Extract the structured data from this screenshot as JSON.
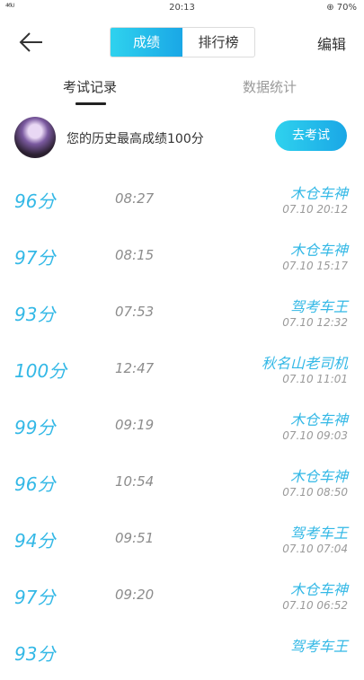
{
  "status_bar": {
    "signal": "⁴⁶ᴸᴵ",
    "time": "20:13",
    "battery": "⊕ 70%"
  },
  "nav": {
    "tab_score": "成绩",
    "tab_rank": "排行榜",
    "edit": "编辑"
  },
  "tabs": {
    "records": "考试记录",
    "stats": "数据统计"
  },
  "best": {
    "text": "您的历史最高成绩100分",
    "button": "去考试"
  },
  "records": [
    {
      "score": "96分",
      "duration": "08:27",
      "title": "木仓车神",
      "date": "07.10  20:12"
    },
    {
      "score": "97分",
      "duration": "08:15",
      "title": "木仓车神",
      "date": "07.10  15:17"
    },
    {
      "score": "93分",
      "duration": "07:53",
      "title": "驾考车王",
      "date": "07.10  12:32"
    },
    {
      "score": "100分",
      "duration": "12:47",
      "title": "秋名山老司机",
      "date": "07.10  11:01"
    },
    {
      "score": "99分",
      "duration": "09:19",
      "title": "木仓车神",
      "date": "07.10  09:03"
    },
    {
      "score": "96分",
      "duration": "10:54",
      "title": "木仓车神",
      "date": "07.10  08:50"
    },
    {
      "score": "94分",
      "duration": "09:51",
      "title": "驾考车王",
      "date": "07.10  07:04"
    },
    {
      "score": "97分",
      "duration": "09:20",
      "title": "木仓车神",
      "date": "07.10  06:52"
    },
    {
      "score": "93分",
      "duration": "",
      "title": "驾考车王",
      "date": ""
    }
  ],
  "colors": {
    "accent": "#1aa7e6",
    "accent_light": "#2fd2ee"
  }
}
